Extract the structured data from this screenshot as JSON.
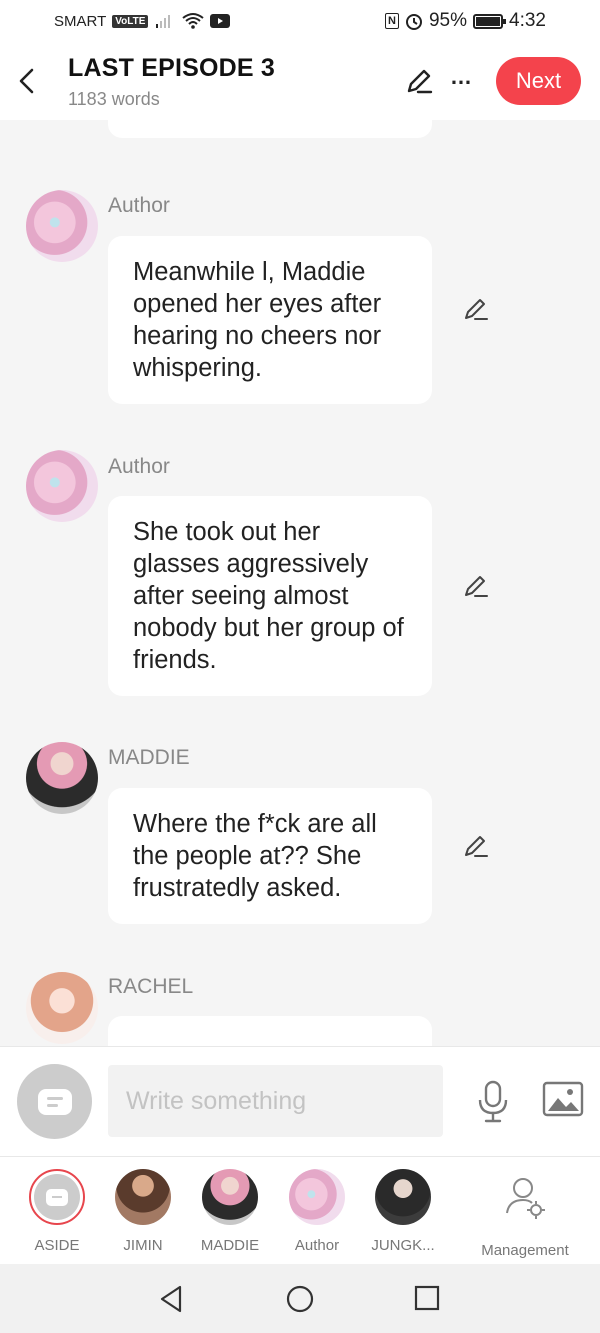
{
  "status_bar": {
    "carrier": "SMART",
    "volte": "VoLTE",
    "nfc": "N",
    "battery_percent": "95%",
    "time": "4:32"
  },
  "header": {
    "title": "LAST EPISODE 3",
    "word_count": "1183 words",
    "next_label": "Next",
    "more_label": "…"
  },
  "messages": [
    {
      "speaker": "Author",
      "avatar": "author-avatar",
      "text": "Meanwhile l, Maddie opened her eyes after hearing no cheers nor whispering."
    },
    {
      "speaker": "Author",
      "avatar": "author-avatar",
      "text": "She took out her glasses aggressively after seeing almost nobody but her group of friends."
    },
    {
      "speaker": "MADDIE",
      "avatar": "maddie-avatar",
      "text": "Where the f*ck are all the people at?? She frustratedly asked."
    },
    {
      "speaker": "RACHEL",
      "avatar": "rachel-avatar",
      "text": ""
    }
  ],
  "input": {
    "placeholder": "Write something"
  },
  "characters": [
    {
      "label": "ASIDE",
      "selected": true
    },
    {
      "label": "JIMIN"
    },
    {
      "label": "MADDIE"
    },
    {
      "label": "Author"
    },
    {
      "label": "JUNGK..."
    },
    {
      "label": "Management"
    }
  ],
  "colors": {
    "accent": "#f4434c",
    "background": "#f5f5f5",
    "bubble": "#ffffff"
  }
}
